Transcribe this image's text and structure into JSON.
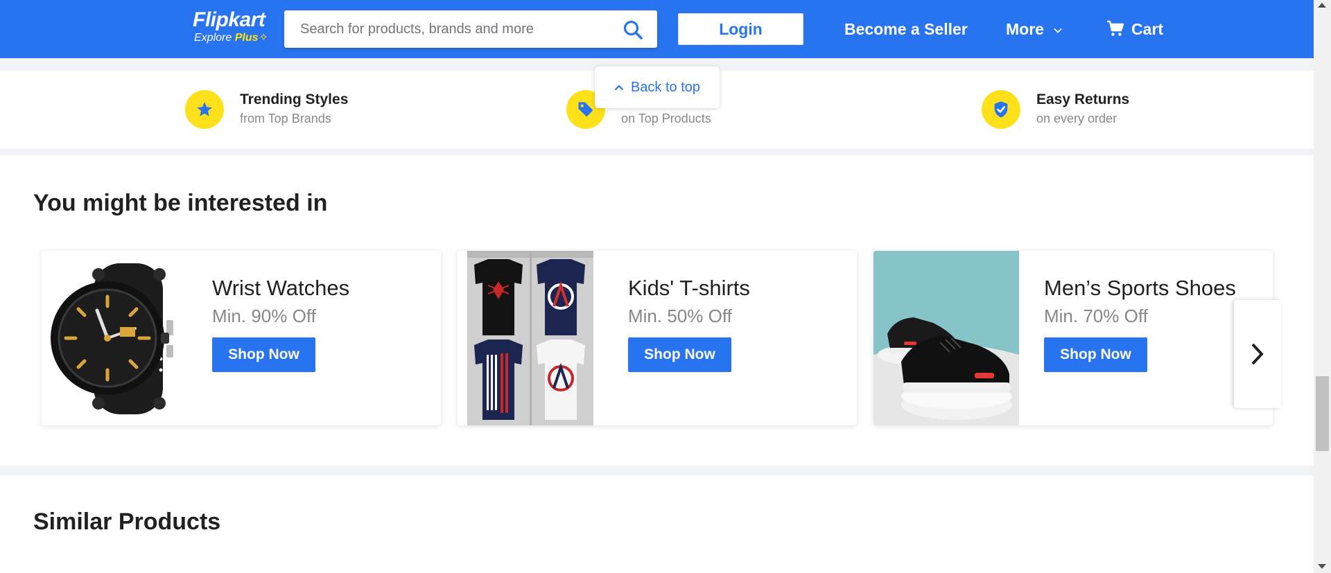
{
  "header": {
    "logo": {
      "name": "Flipkart",
      "tagline": "Explore",
      "tagline_plus": "Plus"
    },
    "search": {
      "placeholder": "Search for products, brands and more",
      "value": ""
    },
    "login_label": "Login",
    "seller_label": "Become a Seller",
    "more_label": "More",
    "cart_label": "Cart"
  },
  "back_to_top": {
    "label": "Back to top"
  },
  "benefits": [
    {
      "title": "Trending Styles",
      "subtitle": "from Top Brands",
      "icon": "star-icon"
    },
    {
      "title": "",
      "subtitle": "on Top Products",
      "icon": "price-tag-icon"
    },
    {
      "title": "Easy Returns",
      "subtitle": "on every order",
      "icon": "shield-check-icon"
    }
  ],
  "interested": {
    "title": "You might be interested in",
    "cards": [
      {
        "name": "Wrist Watches",
        "offer": "Min. 90% Off",
        "button": "Shop Now",
        "image": "wrist-watch-image"
      },
      {
        "name": "Kids' T-shirts",
        "offer": "Min. 50% Off",
        "button": "Shop Now",
        "image": "kids-tshirts-image"
      },
      {
        "name": "Men’s Sports Shoes",
        "offer": "Min. 70% Off",
        "button": "Shop Now",
        "image": "sports-shoes-image"
      }
    ]
  },
  "similar": {
    "title": "Similar Products"
  },
  "colors": {
    "brand_blue": "#2874f0",
    "brand_yellow": "#ffe500",
    "badge_yellow": "#ffe11b",
    "page_bg": "#f1f3f6",
    "muted_text": "#878787"
  }
}
